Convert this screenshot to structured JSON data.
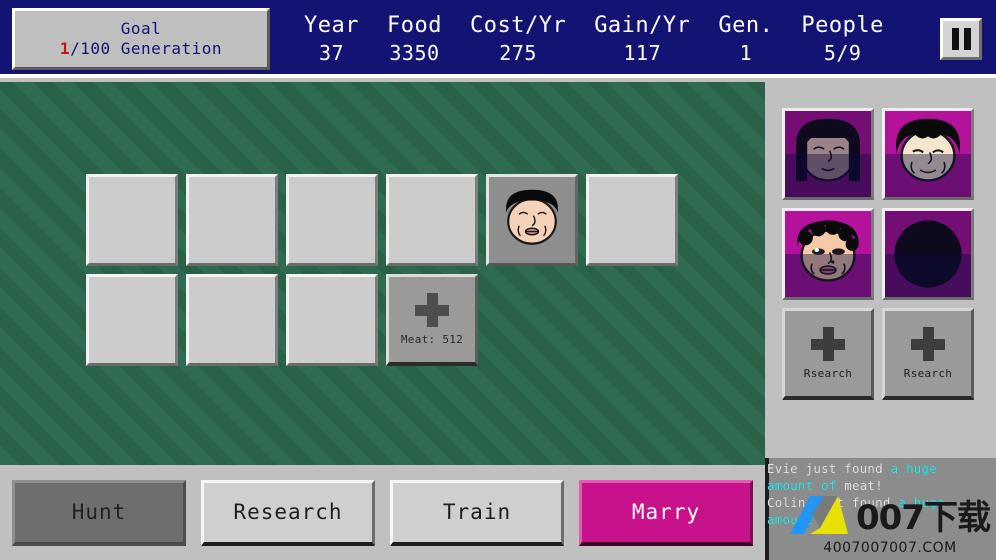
{
  "topbar": {
    "goal": {
      "title": "Goal",
      "current": "1",
      "rest": "/100 Generation"
    },
    "stats": [
      {
        "label": "Year",
        "value": "37"
      },
      {
        "label": "Food",
        "value": "3350"
      },
      {
        "label": "Cost/Yr",
        "value": "275"
      },
      {
        "label": "Gain/Yr",
        "value": "117"
      },
      {
        "label": "Gen.",
        "value": "1"
      },
      {
        "label": "People",
        "value": "5/9"
      }
    ],
    "pause_icon": "pause-icon"
  },
  "field": {
    "slots": [
      {
        "type": "empty",
        "caption": ""
      },
      {
        "type": "empty",
        "caption": ""
      },
      {
        "type": "empty",
        "caption": ""
      },
      {
        "type": "empty",
        "caption": ""
      },
      {
        "type": "person",
        "caption": "",
        "face": "male-dark-hair"
      },
      {
        "type": "empty",
        "caption": ""
      },
      {
        "type": "empty",
        "caption": ""
      },
      {
        "type": "empty",
        "caption": ""
      },
      {
        "type": "empty",
        "caption": ""
      },
      {
        "type": "add",
        "caption": "Meat: 512"
      },
      {
        "type": "hidden",
        "caption": ""
      },
      {
        "type": "hidden",
        "caption": ""
      }
    ]
  },
  "sidebar": {
    "portraits": [
      {
        "type": "portrait",
        "face": "long-dark-hair",
        "dimmed": true,
        "caption": ""
      },
      {
        "type": "portrait",
        "face": "bob-dark-hair",
        "dimmed": false,
        "caption": ""
      },
      {
        "type": "portrait",
        "face": "curly-dark-hair",
        "dimmed": false,
        "caption": ""
      },
      {
        "type": "portrait",
        "face": "hooded-dark",
        "dimmed": true,
        "caption": ""
      },
      {
        "type": "rsearch",
        "face": "",
        "dimmed": false,
        "caption": "Rsearch"
      },
      {
        "type": "rsearch",
        "face": "",
        "dimmed": false,
        "caption": "Rsearch"
      }
    ]
  },
  "log": {
    "lines": [
      {
        "name": "Evie just found ",
        "highlight": "a huge"
      },
      {
        "name": "",
        "highlight": "amount of",
        "tail": " meat!"
      },
      {
        "name": "Colin just found ",
        "highlight": "a huge"
      },
      {
        "name": "",
        "highlight": "amount of"
      }
    ]
  },
  "actions": [
    {
      "label": "Hunt",
      "state": "active"
    },
    {
      "label": "Research",
      "state": "normal"
    },
    {
      "label": "Train",
      "state": "normal"
    },
    {
      "label": "Marry",
      "state": "highlight"
    }
  ],
  "watermark": {
    "text": "007下载",
    "url": "4007007007.COM"
  },
  "colors": {
    "topbar_blue": "#131373",
    "field_green": "#2f6b50",
    "panel_gray": "#c0c0c0",
    "portrait_magenta": "#b4129b",
    "marry_pink": "#c7128c",
    "goal_current_red": "#c81414",
    "log_cyan": "#2ff0f0"
  }
}
